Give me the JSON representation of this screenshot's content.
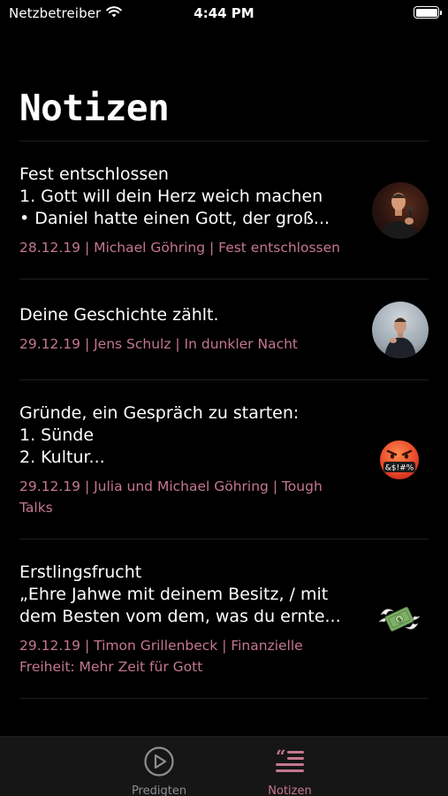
{
  "status_bar": {
    "carrier": "Netzbetreiber",
    "time": "4:44 PM",
    "battery_level": 1.0
  },
  "page": {
    "title": "Notizen"
  },
  "notes": [
    {
      "title": "Fest entschlossen",
      "body": "1. Gott will dein Herz weich machen\n• Daniel hatte einen Gott, der groß...",
      "meta": "28.12.19 | Michael Göhring | Fest entschlossen",
      "image": "speaker-photo"
    },
    {
      "title": "Deine Geschichte zählt.",
      "body": "",
      "meta": "29.12.19 | Jens Schulz | In dunkler Nacht",
      "image": "speaker-photo"
    },
    {
      "title": "Gründe, ein Gespräch zu starten:",
      "body": "1. Sünde\n2. Kultur...",
      "meta": "29.12.19 | Julia und Michael Göhring | Tough Talks",
      "image": "cursing-face-emoji"
    },
    {
      "title": "Erstlingsfrucht",
      "body": "„Ehre Jahwe mit deinem Besitz, / mit dem Besten vom dem, was du ernte...",
      "meta": "29.12.19 | Timon Grillenbeck | Finanzielle Freiheit: Mehr Zeit für Gott",
      "image": "money-with-wings-emoji"
    }
  ],
  "tab_bar": {
    "tabs": [
      {
        "label": "Predigten",
        "icon": "play-circle-icon",
        "active": false
      },
      {
        "label": "Notizen",
        "icon": "quote-lines-icon",
        "active": true
      }
    ]
  },
  "colors": {
    "accent": "#c5778e",
    "background": "#000000",
    "inactive": "#8e8e93"
  }
}
